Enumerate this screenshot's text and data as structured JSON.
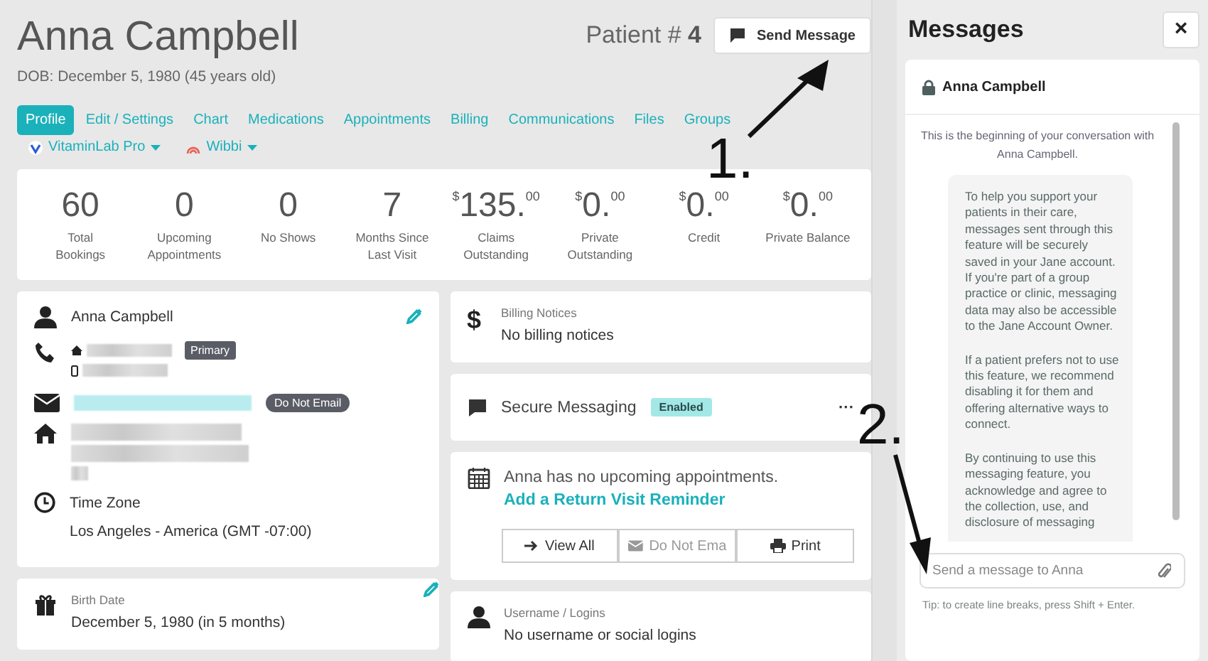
{
  "patient": {
    "name": "Anna Campbell",
    "dob": "DOB: December 5, 1980 (45 years old)",
    "number_label": "Patient #",
    "number": "4"
  },
  "send_button": "Send Message",
  "tabs": [
    {
      "label": "Profile",
      "selected": true
    },
    {
      "label": "Edit / Settings",
      "selected": false
    },
    {
      "label": "Chart",
      "selected": false
    },
    {
      "label": "Medications",
      "selected": false
    },
    {
      "label": "Appointments",
      "selected": false
    },
    {
      "label": "Billing",
      "selected": false
    },
    {
      "label": "Communications",
      "selected": false
    },
    {
      "label": "Files",
      "selected": false
    },
    {
      "label": "Groups",
      "selected": false
    }
  ],
  "integrations": [
    {
      "label": "VitaminLab Pro",
      "kind": "vitaminlab"
    },
    {
      "label": "Wibbi",
      "kind": "wibbi"
    }
  ],
  "stats": [
    {
      "value": "60",
      "label": [
        "Total",
        "Bookings"
      ]
    },
    {
      "value": "0",
      "label": [
        "Upcoming",
        "Appointments"
      ]
    },
    {
      "value": "0",
      "label": [
        "No Shows"
      ]
    },
    {
      "value": "7",
      "label": [
        "Months Since",
        "Last Visit"
      ]
    },
    {
      "prefix": "$",
      "value": "135.",
      "cents": "00",
      "label": [
        "Claims",
        "Outstanding"
      ]
    },
    {
      "prefix": "$",
      "value": "0.",
      "cents": "00",
      "label": [
        "Private",
        "Outstanding"
      ]
    },
    {
      "prefix": "$",
      "value": "0.",
      "cents": "00",
      "label": [
        "Credit"
      ]
    },
    {
      "prefix": "$",
      "value": "0.",
      "cents": "00",
      "label": [
        "Private Balance"
      ]
    }
  ],
  "contact": {
    "name": "Anna Campbell",
    "phone_badge": "Primary",
    "email_badge": "Do Not Email",
    "time_zone_label": "Time Zone",
    "time_zone": "Los Angeles - America (GMT -07:00)"
  },
  "birth": {
    "label": "Birth Date",
    "value": "December 5, 1980 (in 5 months)"
  },
  "billing": {
    "icon": "$",
    "label": "Billing Notices",
    "value": "No billing notices"
  },
  "secure_messaging": {
    "label": "Secure Messaging",
    "badge": "Enabled",
    "menu": "···"
  },
  "appointments": {
    "text": "Anna has no upcoming appointments.",
    "link": "Add a Return Visit Reminder",
    "buttons": [
      {
        "label": "View All",
        "kind": "arrow",
        "disabled": false
      },
      {
        "label": "Do Not Ema",
        "kind": "mail",
        "disabled": true
      },
      {
        "label": "Print",
        "kind": "print",
        "disabled": false
      }
    ]
  },
  "logins": {
    "label": "Username / Logins",
    "value": "No username or social logins"
  },
  "messages": {
    "title": "Messages",
    "close": "×",
    "contact": "Anna Campbell",
    "intro": "This is the beginning of your conversation with Anna Campbell.",
    "bubble": [
      "To help you support your patients in their care, messages sent through this feature will be securely saved in your Jane account. If you're part of a group practice or clinic, messaging data may also be accessible to the Jane Account Owner.",
      "If a patient prefers not to use this feature, we recommend disabling it for them and offering alternative ways to connect.",
      "By continuing to use this messaging feature, you acknowledge and agree to the collection, use, and disclosure of messaging"
    ],
    "placeholder": "Send a message to Anna",
    "tip": "Tip: to create line breaks, press Shift + Enter."
  },
  "annotations": [
    {
      "label": "1."
    },
    {
      "label": "2."
    }
  ]
}
